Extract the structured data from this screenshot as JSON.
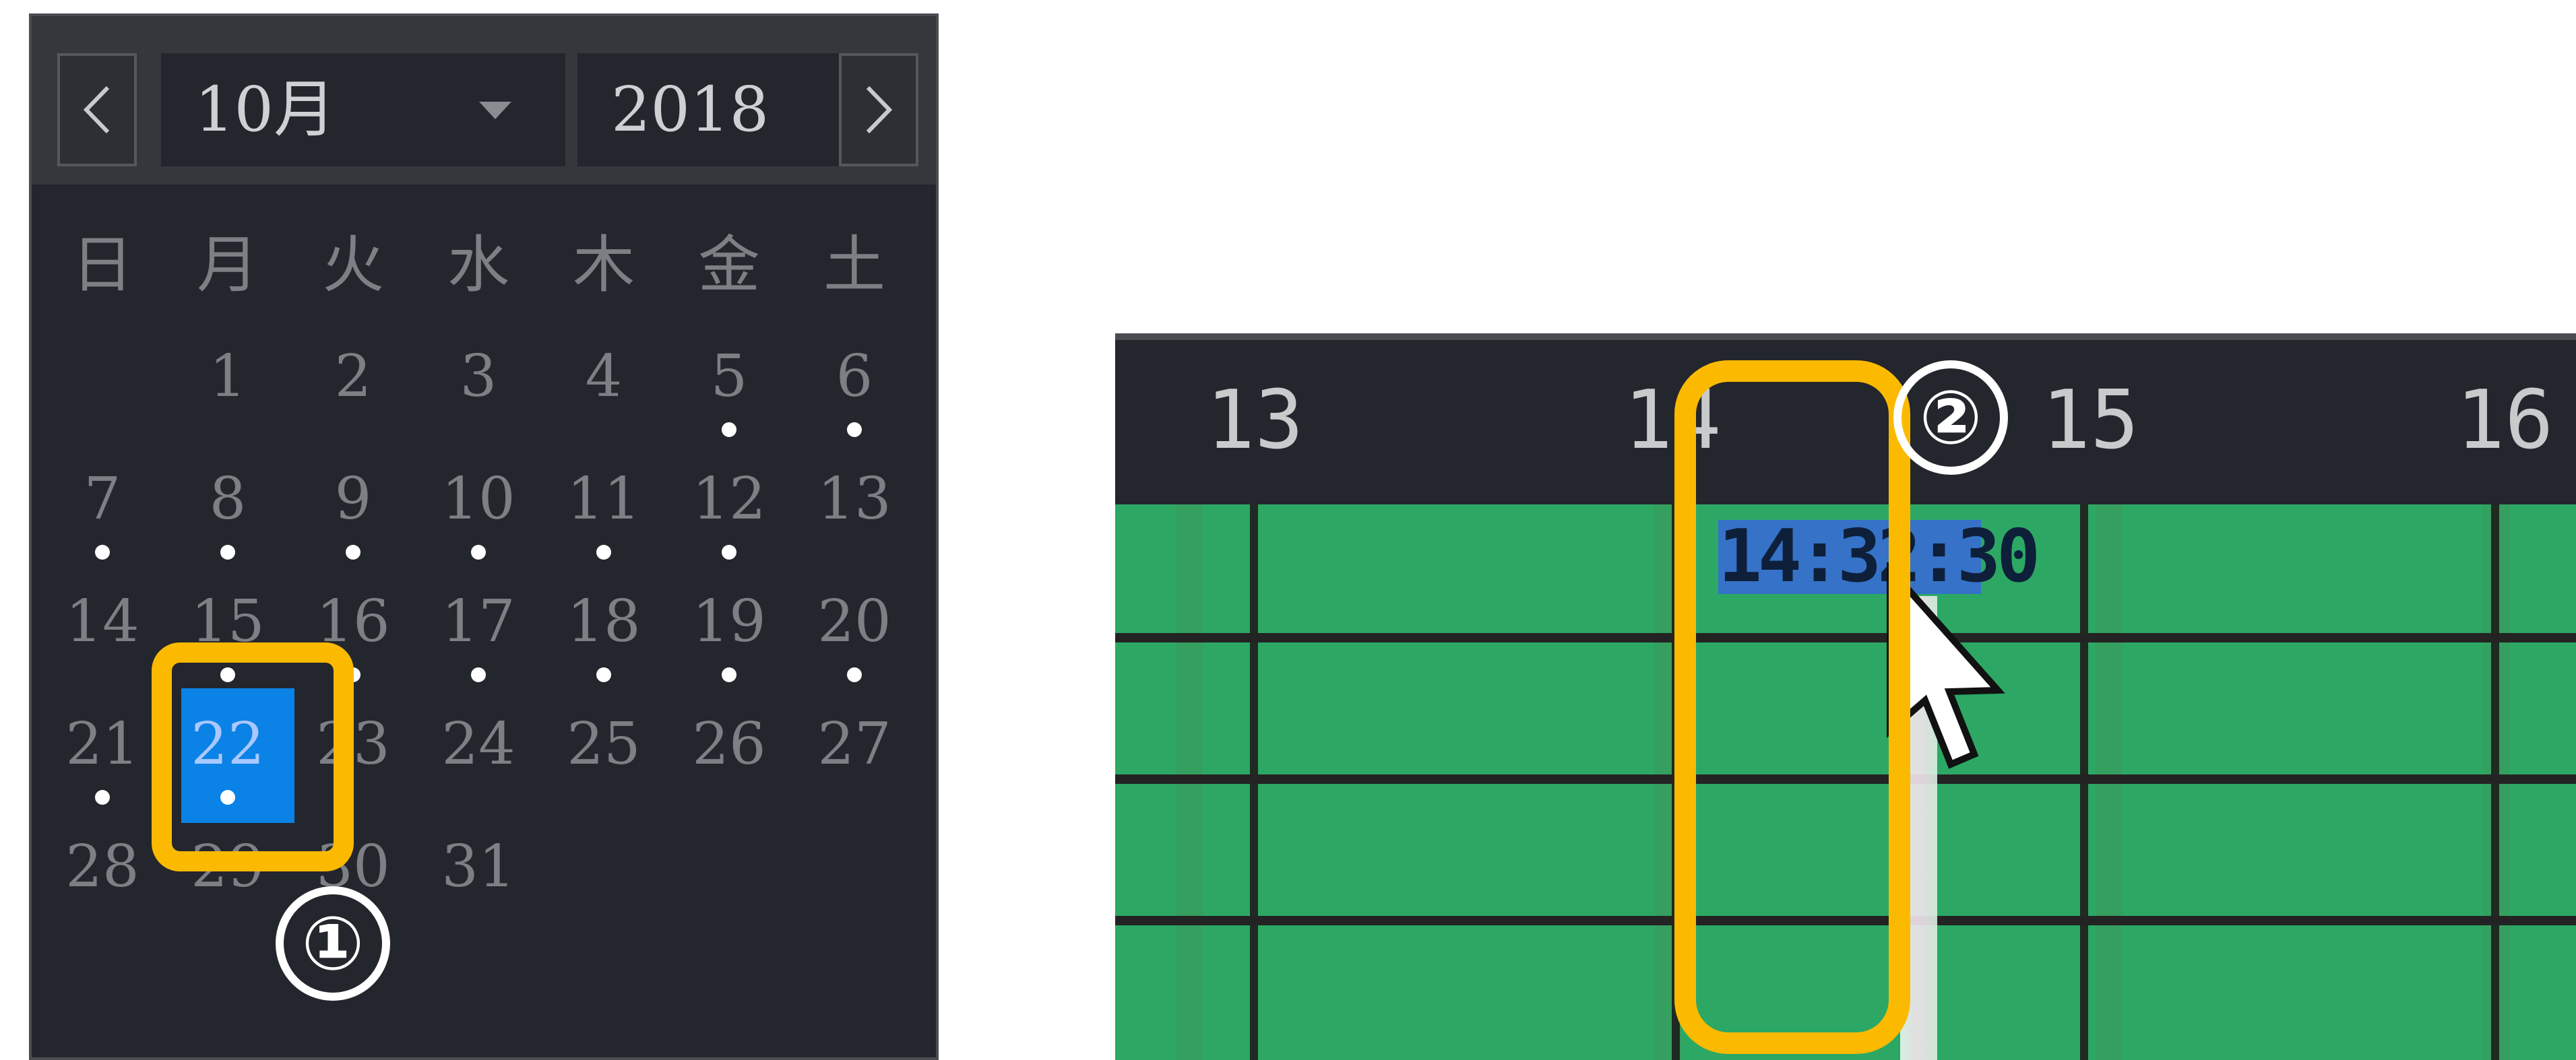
{
  "calendar": {
    "month": "10月",
    "year": "2018",
    "prev_icon": "chevron-left-icon",
    "next_icon": "chevron-right-icon",
    "dropdown_icon": "caret-down-icon",
    "weekdays": [
      "日",
      "月",
      "火",
      "水",
      "木",
      "金",
      "土"
    ],
    "days": [
      {
        "label": "1",
        "col": 1,
        "row": 0,
        "has_record": false
      },
      {
        "label": "2",
        "col": 2,
        "row": 0,
        "has_record": false
      },
      {
        "label": "3",
        "col": 3,
        "row": 0,
        "has_record": false
      },
      {
        "label": "4",
        "col": 4,
        "row": 0,
        "has_record": false
      },
      {
        "label": "5",
        "col": 5,
        "row": 0,
        "has_record": true
      },
      {
        "label": "6",
        "col": 6,
        "row": 0,
        "has_record": true
      },
      {
        "label": "7",
        "col": 0,
        "row": 1,
        "has_record": true
      },
      {
        "label": "8",
        "col": 1,
        "row": 1,
        "has_record": true
      },
      {
        "label": "9",
        "col": 2,
        "row": 1,
        "has_record": true
      },
      {
        "label": "10",
        "col": 3,
        "row": 1,
        "has_record": true
      },
      {
        "label": "11",
        "col": 4,
        "row": 1,
        "has_record": true
      },
      {
        "label": "12",
        "col": 5,
        "row": 1,
        "has_record": true
      },
      {
        "label": "13",
        "col": 6,
        "row": 1,
        "has_record": false
      },
      {
        "label": "14",
        "col": 0,
        "row": 2,
        "has_record": false
      },
      {
        "label": "15",
        "col": 1,
        "row": 2,
        "has_record": true
      },
      {
        "label": "16",
        "col": 2,
        "row": 2,
        "has_record": true
      },
      {
        "label": "17",
        "col": 3,
        "row": 2,
        "has_record": true
      },
      {
        "label": "18",
        "col": 4,
        "row": 2,
        "has_record": true
      },
      {
        "label": "19",
        "col": 5,
        "row": 2,
        "has_record": true
      },
      {
        "label": "20",
        "col": 6,
        "row": 2,
        "has_record": true
      },
      {
        "label": "21",
        "col": 0,
        "row": 3,
        "has_record": true
      },
      {
        "label": "22",
        "col": 1,
        "row": 3,
        "has_record": true,
        "selected": true
      },
      {
        "label": "23",
        "col": 2,
        "row": 3,
        "has_record": false
      },
      {
        "label": "24",
        "col": 3,
        "row": 3,
        "has_record": false
      },
      {
        "label": "25",
        "col": 4,
        "row": 3,
        "has_record": false
      },
      {
        "label": "26",
        "col": 5,
        "row": 3,
        "has_record": false
      },
      {
        "label": "27",
        "col": 6,
        "row": 3,
        "has_record": false
      },
      {
        "label": "28",
        "col": 0,
        "row": 4,
        "has_record": false
      },
      {
        "label": "29",
        "col": 1,
        "row": 4,
        "has_record": false
      },
      {
        "label": "30",
        "col": 2,
        "row": 4,
        "has_record": false
      },
      {
        "label": "31",
        "col": 3,
        "row": 4,
        "has_record": false
      }
    ],
    "selected_color": "#0a82e6",
    "highlight_color": "#fbba00"
  },
  "annotations": {
    "step1": "①",
    "step2": "②"
  },
  "timeline": {
    "hours": [
      "13",
      "14",
      "15",
      "16"
    ],
    "time_label": "14:32:30",
    "bar_color": "#2ca864",
    "cursor_icon": "mouse-pointer-icon"
  }
}
